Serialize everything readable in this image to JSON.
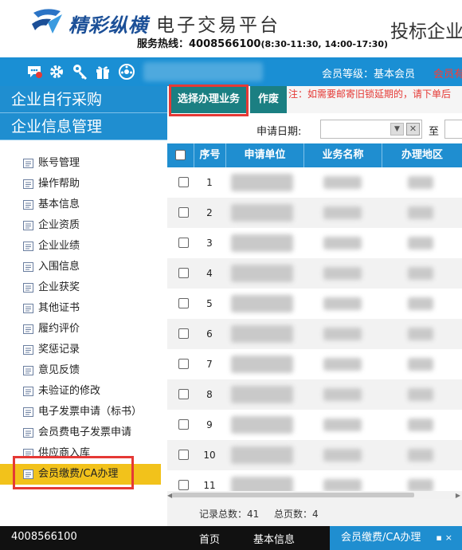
{
  "header": {
    "brand_main": "精彩纵横",
    "brand_sub": "电子交易平台",
    "hotline_label": "服务热线：4008566100",
    "hotline_hours": "(8:30-11:30, 14:00-17:30)",
    "right_title": "投标企业"
  },
  "topbar": {
    "icons": [
      "message-icon",
      "gear-icon",
      "key-icon",
      "gift-icon",
      "dashboard-icon"
    ],
    "member_level": "会员等级：基本会员",
    "member_red": "会员有"
  },
  "sidebar": {
    "sections": [
      "企业自行采购",
      "企业信息管理"
    ],
    "items": [
      {
        "label": "账号管理"
      },
      {
        "label": "操作帮助"
      },
      {
        "label": "基本信息"
      },
      {
        "label": "企业资质"
      },
      {
        "label": "企业业绩"
      },
      {
        "label": "入围信息"
      },
      {
        "label": "企业获奖"
      },
      {
        "label": "其他证书"
      },
      {
        "label": "履约评价"
      },
      {
        "label": "奖惩记录"
      },
      {
        "label": "意见反馈"
      },
      {
        "label": "未验证的修改"
      },
      {
        "label": "电子发票申请（标书）"
      },
      {
        "label": "会员费电子发票申请"
      },
      {
        "label": "供应商入库"
      },
      {
        "label": "会员缴费/CA办理"
      }
    ]
  },
  "main": {
    "tab_select": "选择办理业务",
    "tab_void": "作废",
    "notice": "注：如需要邮寄旧锁延期的，请下单后",
    "filter_label": "申请日期:",
    "filter_to": "至",
    "columns": [
      "序号",
      "申请单位",
      "业务名称",
      "办理地区"
    ],
    "rows": [
      "1",
      "2",
      "3",
      "4",
      "5",
      "6",
      "7",
      "8",
      "9",
      "10",
      "11"
    ],
    "total_label": "记录总数：41",
    "pages_label": "总页数：4"
  },
  "bottombar": {
    "phone": "4008566100",
    "links": [
      "首页",
      "基本信息"
    ],
    "current": "会员缴费/CA办理"
  },
  "colors": {
    "blue": "#1f8ed0",
    "teal": "#1b7f82",
    "active": "#f2c21b",
    "highlight_box": "#e53935"
  }
}
